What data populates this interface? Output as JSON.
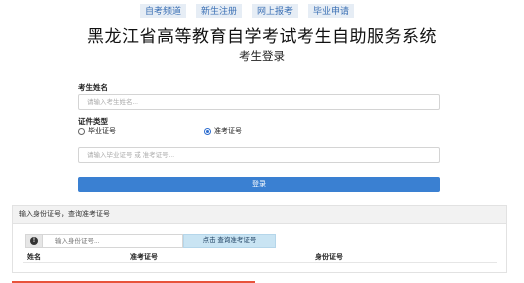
{
  "top_nav": [
    "自考频道",
    "新生注册",
    "网上报考",
    "毕业申请"
  ],
  "site_title": "黑龙江省高等教育自学考试考生自助服务系统",
  "page_title": "考生登录",
  "login_form": {
    "name_label": "考生姓名",
    "name_placeholder": "请输入考生姓名...",
    "cert_type_label": "证件类型",
    "cert_options": [
      {
        "label": "毕业证号",
        "selected": false
      },
      {
        "label": "准考证号",
        "selected": true
      }
    ],
    "cert_placeholder": "请输入毕业证号 或 准考证号...",
    "login_button": "登录"
  },
  "query": {
    "heading": "输入身份证号，查询准考证号",
    "info_icon": "info-icon",
    "id_placeholder": "输入身份证号...",
    "query_button": "点击 查询准考证号",
    "columns": [
      "姓名",
      "准考证号",
      "身份证号"
    ]
  },
  "colors": {
    "nav_text": "#3a6fb4",
    "nav_bg": "#e6edf5",
    "login_button_bg": "#3a80d2",
    "query_button_bg": "#c9e4f3",
    "accent_bar": "#e8533b"
  }
}
